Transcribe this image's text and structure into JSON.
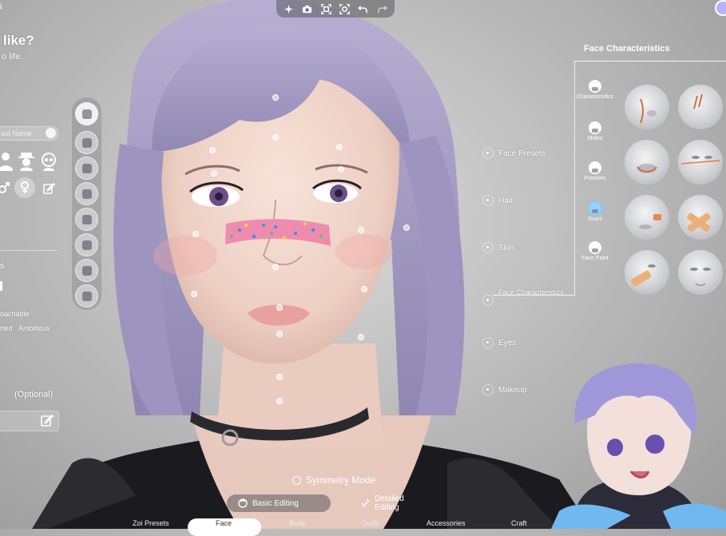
{
  "toolbar": {
    "icons": [
      "sparkle-icon",
      "camera-icon",
      "frame-icon",
      "face-frame-icon",
      "undo-icon",
      "redo-icon"
    ]
  },
  "top_left": {
    "fragment": "i"
  },
  "left_panel": {
    "heading_fragment": "like?",
    "sub_fragment": "o life.",
    "name_placeholder": "ast Name",
    "trait_approachable": "oachable",
    "trait_row": "rted",
    "trait_ambitious": "Ambitious",
    "optional_label": "(Optional)",
    "section_fragment": "s"
  },
  "menu": {
    "items": [
      "Face Presets",
      "Hair",
      "Skin",
      "Face Characteristics",
      "Eyes",
      "Makeup"
    ],
    "active": "Face Characteristics"
  },
  "face_characteristics": {
    "title": "Face Characteristics",
    "categories": [
      "Characteristics",
      "Moles",
      "Freckles",
      "Scars",
      "Face Paint"
    ],
    "active_category": "Scars"
  },
  "bottom": {
    "symmetry_label": "Symmetry Mode",
    "basic_editing": "Basic Editing",
    "detailed_editing": "Detailed Editing",
    "tabs": [
      "Zoi Presets",
      "Face",
      "Body",
      "Outfit",
      "Accessories",
      "Craft"
    ],
    "active_tab": "Face"
  },
  "colors": {
    "hair": "#a9a1c6",
    "skin": "#f2d9cf",
    "bandage": "#f08bb0",
    "accent_active": "#8fd4ff"
  }
}
